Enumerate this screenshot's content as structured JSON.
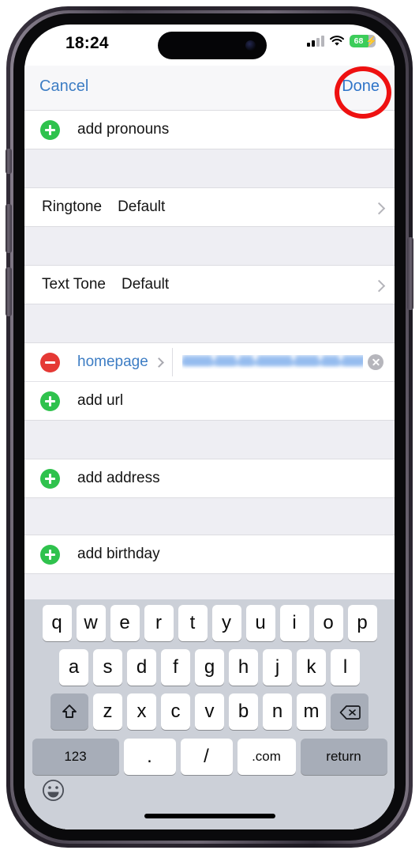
{
  "status_bar": {
    "time": "18:24",
    "signal_icon": "cellular-signal-icon",
    "wifi_icon": "wifi-icon",
    "battery_percent": "68",
    "battery_charging_icon": "lightning-bolt-icon",
    "battery_color": "#3ccd5a"
  },
  "nav": {
    "cancel_label": "Cancel",
    "done_label": "Done",
    "accent_color": "#2f74c8"
  },
  "annotation": {
    "color": "#ee1111",
    "target": "Done"
  },
  "list": {
    "sections": [
      {
        "rows": [
          {
            "type": "add",
            "icon": "plus-circle-icon",
            "label": "add pronouns"
          }
        ]
      },
      {
        "rows": [
          {
            "type": "value",
            "key": "Ringtone",
            "value": "Default",
            "accessory": "chevron-right-icon"
          }
        ]
      },
      {
        "rows": [
          {
            "type": "value",
            "key": "Text Tone",
            "value": "Default",
            "accessory": "chevron-right-icon"
          }
        ]
      },
      {
        "rows": [
          {
            "type": "field",
            "icon": "minus-circle-icon",
            "label": "homepage",
            "label_accessory": "chevron-right-icon",
            "value": "",
            "redacted": true,
            "clear_icon": "clear-field-icon"
          },
          {
            "type": "add",
            "icon": "plus-circle-icon",
            "label": "add url"
          }
        ]
      },
      {
        "rows": [
          {
            "type": "add",
            "icon": "plus-circle-icon",
            "label": "add address"
          }
        ]
      },
      {
        "rows": [
          {
            "type": "add",
            "icon": "plus-circle-icon",
            "label": "add birthday"
          }
        ]
      }
    ]
  },
  "keyboard": {
    "type": "url",
    "row1": [
      "q",
      "w",
      "e",
      "r",
      "t",
      "y",
      "u",
      "i",
      "o",
      "p"
    ],
    "row2": [
      "a",
      "s",
      "d",
      "f",
      "g",
      "h",
      "j",
      "k",
      "l"
    ],
    "row3_letters": [
      "z",
      "x",
      "c",
      "v",
      "b",
      "n",
      "m"
    ],
    "shift_icon": "shift-arrow-icon",
    "backspace_icon": "delete-backward-icon",
    "numbers_label": "123",
    "period_label": ".",
    "slash_label": "/",
    "dotcom_label": ".com",
    "return_label": "return",
    "emoji_icon": "emoji-smiley-icon"
  }
}
